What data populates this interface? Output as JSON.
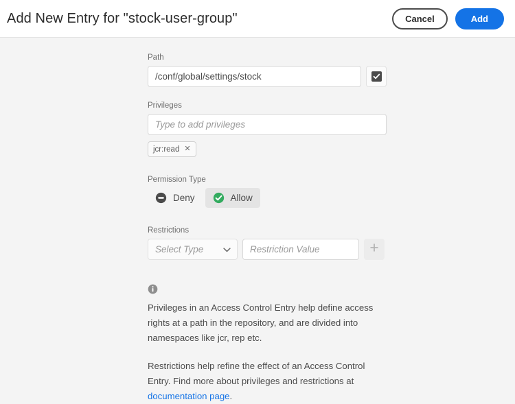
{
  "header": {
    "title": "Add New Entry for \"stock-user-group\"",
    "cancel_label": "Cancel",
    "add_label": "Add"
  },
  "colors": {
    "accent": "#1473e6",
    "allow_green": "#33ab5f",
    "deny_gray": "#4b4b4b",
    "page_bg": "#f4f4f4",
    "header_bg": "#ffffff"
  },
  "form": {
    "path": {
      "label": "Path",
      "value": "/conf/global/settings/stock",
      "placeholder": "Path",
      "checkbox_checked": true
    },
    "privileges": {
      "label": "Privileges",
      "placeholder": "Type to add privileges",
      "value": "",
      "tags": [
        {
          "label": "jcr:read",
          "remove": "✕"
        }
      ]
    },
    "permission_type": {
      "label": "Permission Type",
      "options": [
        {
          "label": "Deny",
          "selected": false,
          "icon": "minus-circle-icon"
        },
        {
          "label": "Allow",
          "selected": true,
          "icon": "check-circle-icon"
        }
      ]
    },
    "restrictions": {
      "label": "Restrictions",
      "type_placeholder": "Select Type",
      "type_value": "",
      "value_placeholder": "Restriction Value",
      "value": "",
      "add_label": "+"
    }
  },
  "info": {
    "paragraph1": "Privileges in an Access Control Entry help define access rights at a path in the repository, and are divided into namespaces like jcr, rep etc.",
    "paragraph2_before": "Restrictions help refine the effect of an Access Control Entry. Find more about privileges and restrictions at ",
    "paragraph2_link": "documentation page",
    "paragraph2_after": "."
  }
}
